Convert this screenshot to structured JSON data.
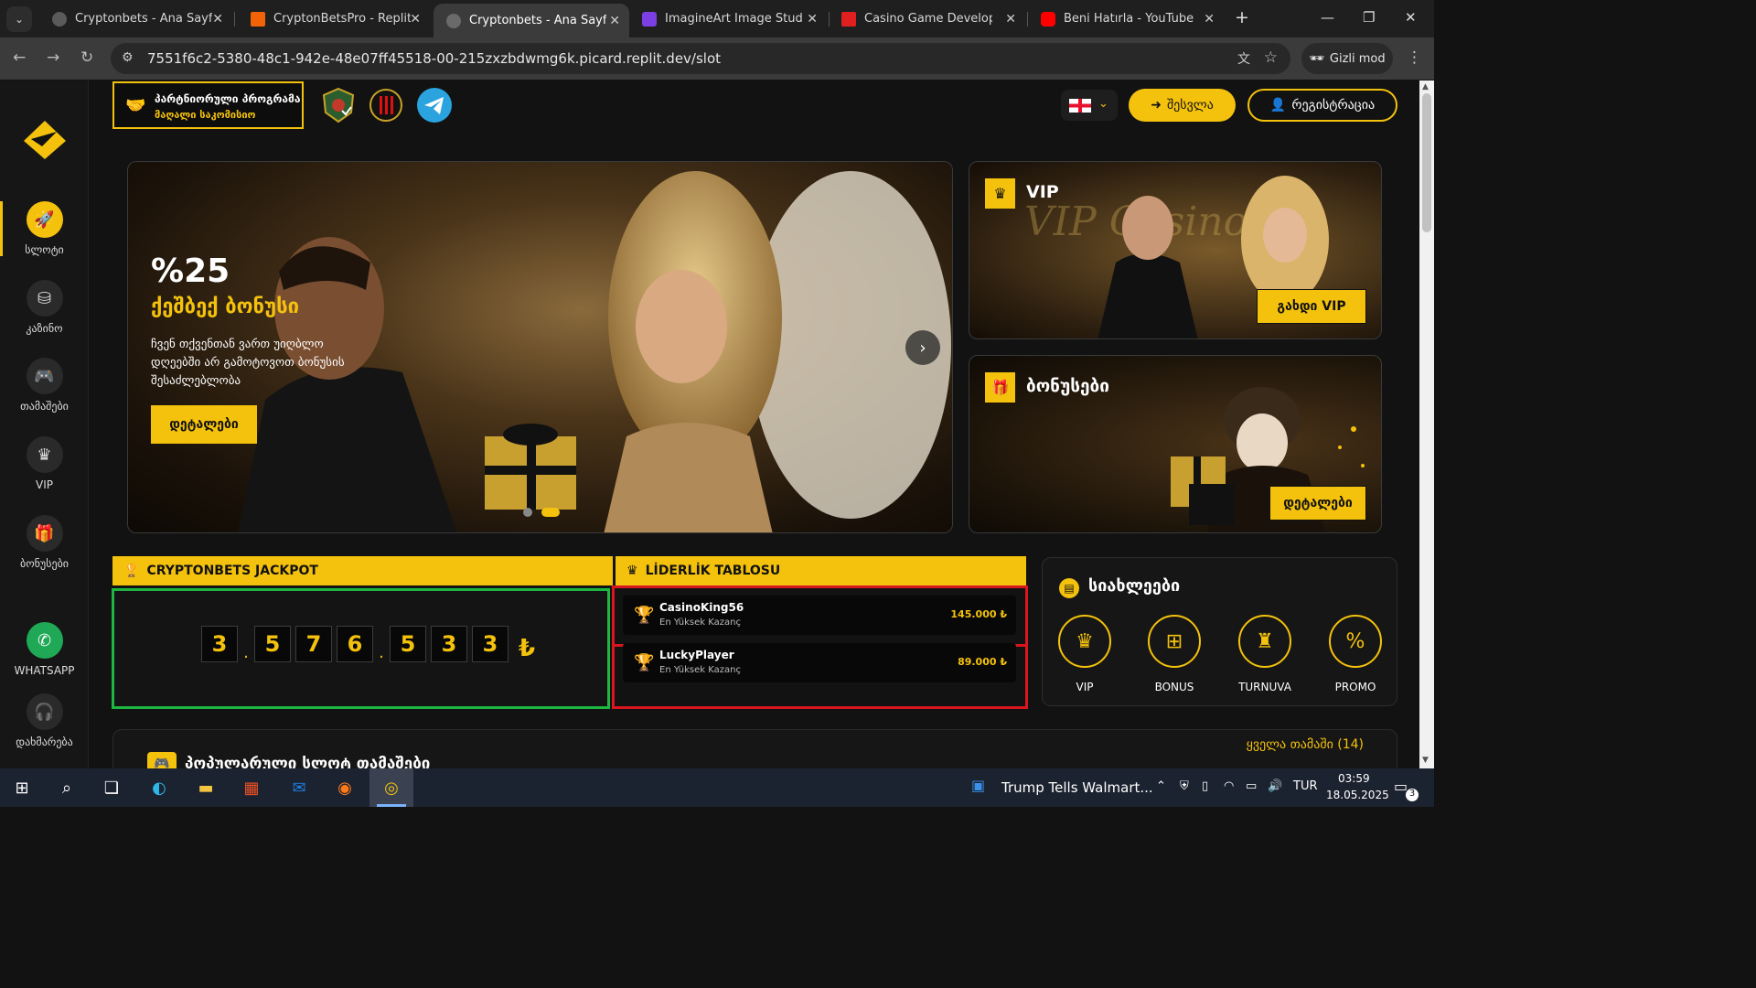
{
  "browser": {
    "tabs": [
      {
        "title": "Cryptonbets - Ana Sayfa",
        "icon": "globe-icon",
        "active": false
      },
      {
        "title": "CryptonBetsPro - Replit",
        "icon": "replit-icon",
        "active": false
      },
      {
        "title": "Cryptonbets - Ana Sayfa",
        "icon": "globe-icon",
        "active": true
      },
      {
        "title": "ImagineArt Image Studio",
        "icon": "imagineart-icon",
        "active": false
      },
      {
        "title": "Casino Game Developers: C",
        "icon": "casino-icon",
        "active": false
      },
      {
        "title": "Beni Hatırla - YouTube",
        "icon": "youtube-icon",
        "active": false
      }
    ],
    "url": "7551f6c2-5380-48c1-942e-48e07ff45518-00-215zxzbdwmg6k.picard.replit.dev/slot",
    "incognito_label": "Gizli mod"
  },
  "sidebar": {
    "items": [
      {
        "label": "სლოტი",
        "icon": "rocket-icon"
      },
      {
        "label": "კაზინო",
        "icon": "coins-icon"
      },
      {
        "label": "თამაშები",
        "icon": "gamepad-icon"
      },
      {
        "label": "VIP",
        "icon": "crown-icon"
      },
      {
        "label": "ბონუსები",
        "icon": "gift-icon"
      },
      {
        "label": "WHATSAPP",
        "icon": "whatsapp-icon"
      },
      {
        "label": "დახმარება",
        "icon": "headset-icon"
      }
    ]
  },
  "header": {
    "partner_title": "პარტნიორული პროგრამა",
    "partner_subtitle": "მაღალი საკომისიო",
    "login_label": "შესვლა",
    "register_label": "რეგისტრაცია"
  },
  "hero": {
    "percent": "%25",
    "title": "ქეშბექ ბონუსი",
    "description": "ჩვენ თქვენთან ვართ უიღბლო დღეებში არ გამოტოვოთ ბონუსის შესაძლებლობა",
    "cta": "დეტალები",
    "slides_total": 2,
    "active_slide": 2
  },
  "promos": {
    "vip": {
      "title": "VIP",
      "button": "გახდი VIP"
    },
    "bonus": {
      "title": "ბონუსები",
      "button": "დეტალები"
    }
  },
  "jackpot": {
    "title": "CRYPTONBETS JACKPOT",
    "digits": [
      "3",
      ".",
      "5",
      "7",
      "6",
      ".",
      "5",
      "3",
      "3"
    ],
    "currency": "₺"
  },
  "leaderboard": {
    "title": "LİDERLİK TABLOSU",
    "rows": [
      {
        "name": "CasinoKing56",
        "subtitle": "En Yüksek Kazanç",
        "amount": "145.000 ₺"
      },
      {
        "name": "LuckyPlayer",
        "subtitle": "En Yüksek Kazanç",
        "amount": "89.000 ₺"
      }
    ]
  },
  "news": {
    "title": "სიახლეები",
    "items": [
      {
        "label": "VIP",
        "icon": "crown-icon"
      },
      {
        "label": "BONUS",
        "icon": "gift-icon"
      },
      {
        "label": "TURNUVA",
        "icon": "trophy-icon"
      },
      {
        "label": "PROMO",
        "icon": "percent-icon"
      }
    ]
  },
  "popular": {
    "title": "პოპულარული სლოტ თამაშები",
    "all_link": "ყველა თამაში (14)"
  },
  "taskbar": {
    "news_text": "Trump Tells Walmart...",
    "lang": "TUR",
    "time": "03:59",
    "date": "18.05.2025",
    "notif_count": "3"
  },
  "colors": {
    "accent": "#f4c20d",
    "green_frame": "#1db640",
    "red_frame": "#d9161f"
  }
}
